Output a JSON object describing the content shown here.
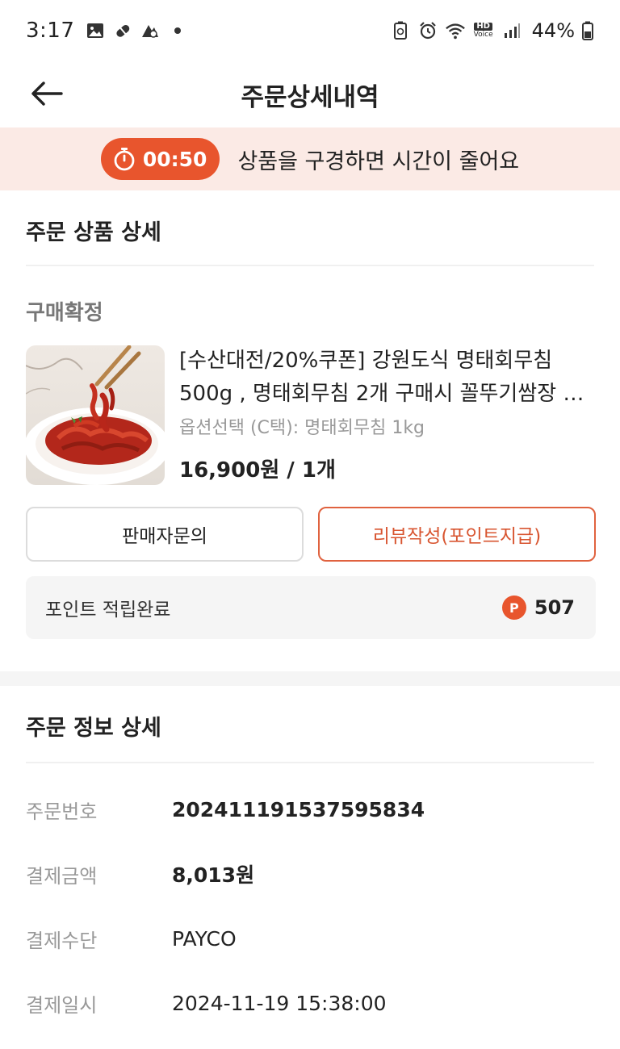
{
  "status_bar": {
    "time": "3:17",
    "battery": "44%",
    "hd_label": "HD",
    "voice_label": "Voice"
  },
  "header": {
    "title": "주문상세내역",
    "back_icon": "arrow-left-icon"
  },
  "timer_banner": {
    "time": "00:50",
    "message": "상품을 구경하면 시간이 줄어요",
    "accent_color": "#e8552d",
    "background": "#fbeae5"
  },
  "product_section": {
    "title": "주문 상품 상세",
    "status": "구매확정",
    "product": {
      "name": "[수산대전/20%쿠폰] 강원도식 명태회무침 500g , 명태회무침 2개 구매시 꼴뚜기쌈장 증정",
      "option": "옵션선택 (C택): 명태회무침 1kg",
      "price": "16,900원 / 1개"
    },
    "buttons": {
      "seller_inquiry": "판매자문의",
      "write_review": "리뷰작성(포인트지급)"
    },
    "points": {
      "label": "포인트 적립완료",
      "badge": "P",
      "value": "507"
    }
  },
  "order_info": {
    "title": "주문 정보 상세",
    "rows": [
      {
        "label": "주문번호",
        "value": "20241119153759583​4"
      },
      {
        "label": "결제금액",
        "value": "8,013원"
      },
      {
        "label": "결제수단",
        "value": "PAYCO"
      },
      {
        "label": "결제일시",
        "value": "2024-11-19 15:38:00"
      }
    ]
  }
}
